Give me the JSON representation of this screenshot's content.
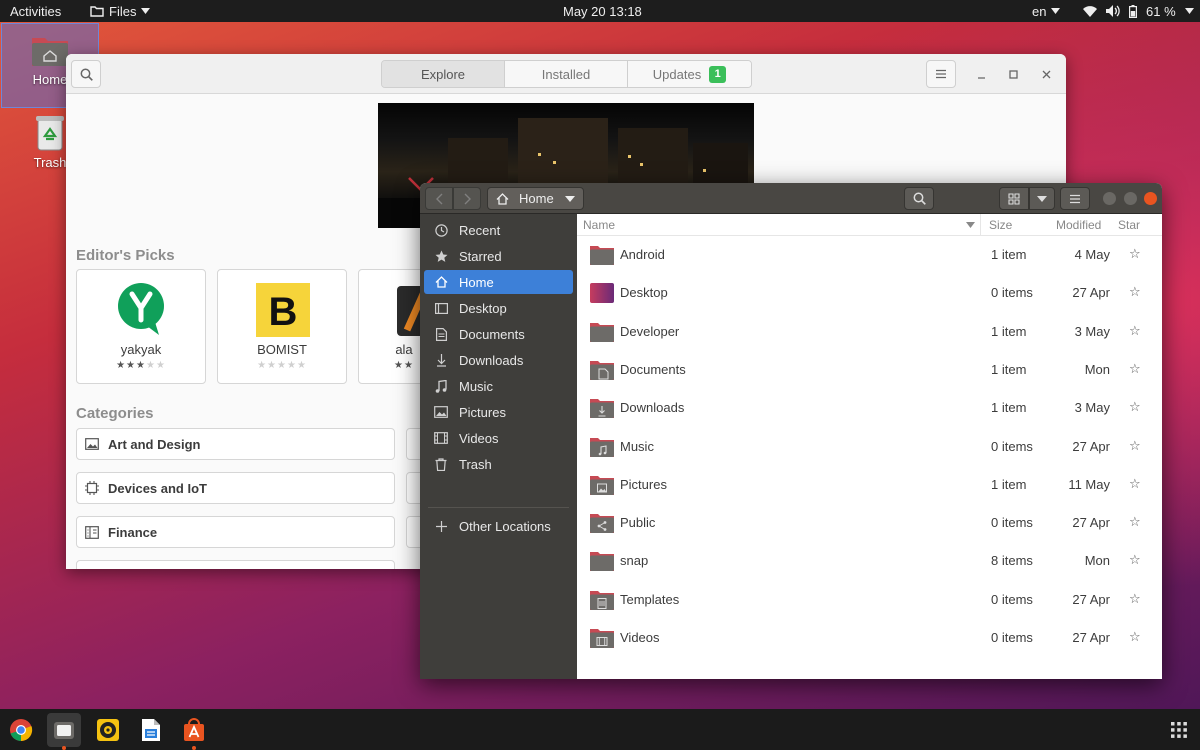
{
  "topbar": {
    "activities": "Activities",
    "app_menu": "Files",
    "clock": "May 20  13:18",
    "keyboard": "en",
    "battery": "61 %",
    "icons": [
      "files-app-icon",
      "wifi-icon",
      "volume-icon",
      "battery-icon",
      "chevron-down-icon"
    ]
  },
  "desktop": {
    "icons": [
      {
        "label": "Home",
        "icon": "home-folder-icon"
      },
      {
        "label": "Trash",
        "icon": "trash-icon"
      }
    ]
  },
  "software": {
    "tabs": [
      {
        "label": "Explore",
        "active": true
      },
      {
        "label": "Installed",
        "active": false
      },
      {
        "label": "Updates",
        "active": false,
        "badge": "1"
      }
    ],
    "editors_picks": "Editor's Picks",
    "picks": [
      {
        "name": "yakyak",
        "rating": 3,
        "icon": "yakyak-icon"
      },
      {
        "name": "BOMIST",
        "rating": 0,
        "icon": "bomist-icon"
      },
      {
        "name": "ala",
        "rating": 2,
        "icon": "alacritty-icon"
      }
    ],
    "categories_title": "Categories",
    "categories": [
      {
        "label": "Art and Design",
        "icon": "image-icon"
      },
      {
        "label": "Devices and IoT",
        "icon": "chip-icon"
      },
      {
        "label": "Finance",
        "icon": "finance-icon"
      }
    ],
    "icons": [
      "search-icon",
      "menu-icon",
      "minimize-icon",
      "maximize-icon",
      "close-icon"
    ]
  },
  "files": {
    "location": "Home",
    "sidebar": [
      {
        "label": "Recent",
        "icon": "clock-icon"
      },
      {
        "label": "Starred",
        "icon": "star-icon"
      },
      {
        "label": "Home",
        "icon": "home-icon",
        "active": true
      },
      {
        "label": "Desktop",
        "icon": "desktop-icon"
      },
      {
        "label": "Documents",
        "icon": "document-icon"
      },
      {
        "label": "Downloads",
        "icon": "download-icon"
      },
      {
        "label": "Music",
        "icon": "music-icon"
      },
      {
        "label": "Pictures",
        "icon": "picture-icon"
      },
      {
        "label": "Videos",
        "icon": "video-icon"
      },
      {
        "label": "Trash",
        "icon": "trash-icon"
      }
    ],
    "other_locations": "Other Locations",
    "columns": {
      "name": "Name",
      "size": "Size",
      "modified": "Modified",
      "star": "Star"
    },
    "rows": [
      {
        "name": "Android",
        "size": "1 item",
        "modified": "4 May",
        "emblem": ""
      },
      {
        "name": "Desktop",
        "size": "0 items",
        "modified": "27 Apr",
        "emblem": "desktop"
      },
      {
        "name": "Developer",
        "size": "1 item",
        "modified": "3 May",
        "emblem": ""
      },
      {
        "name": "Documents",
        "size": "1 item",
        "modified": "Mon",
        "emblem": "document"
      },
      {
        "name": "Downloads",
        "size": "1 item",
        "modified": "3 May",
        "emblem": "download"
      },
      {
        "name": "Music",
        "size": "0 items",
        "modified": "27 Apr",
        "emblem": "music"
      },
      {
        "name": "Pictures",
        "size": "1 item",
        "modified": "11 May",
        "emblem": "picture"
      },
      {
        "name": "Public",
        "size": "0 items",
        "modified": "27 Apr",
        "emblem": "share"
      },
      {
        "name": "snap",
        "size": "8 items",
        "modified": "Mon",
        "emblem": ""
      },
      {
        "name": "Templates",
        "size": "0 items",
        "modified": "27 Apr",
        "emblem": "template"
      },
      {
        "name": "Videos",
        "size": "0 items",
        "modified": "27 Apr",
        "emblem": "video"
      }
    ],
    "star_glyph": "☆",
    "icons": [
      "back-icon",
      "forward-icon",
      "home-icon",
      "search-icon",
      "grid-view-icon",
      "menu-icon"
    ]
  },
  "dock": {
    "apps": [
      {
        "name": "Chrome",
        "icon": "chrome-icon",
        "running": false
      },
      {
        "name": "Files",
        "icon": "files-icon",
        "running": true
      },
      {
        "name": "Rhythmbox",
        "icon": "rhythmbox-icon",
        "running": false
      },
      {
        "name": "LibreOffice Writer",
        "icon": "writer-icon",
        "running": false
      },
      {
        "name": "Ubuntu Software",
        "icon": "software-icon",
        "running": true
      }
    ]
  },
  "colors": {
    "accent": "#3d80d8",
    "ubuntu_orange": "#e95420",
    "folder": "#6d6b68",
    "folder_tab": "#c64a54",
    "update_badge": "#3bbf5a"
  }
}
